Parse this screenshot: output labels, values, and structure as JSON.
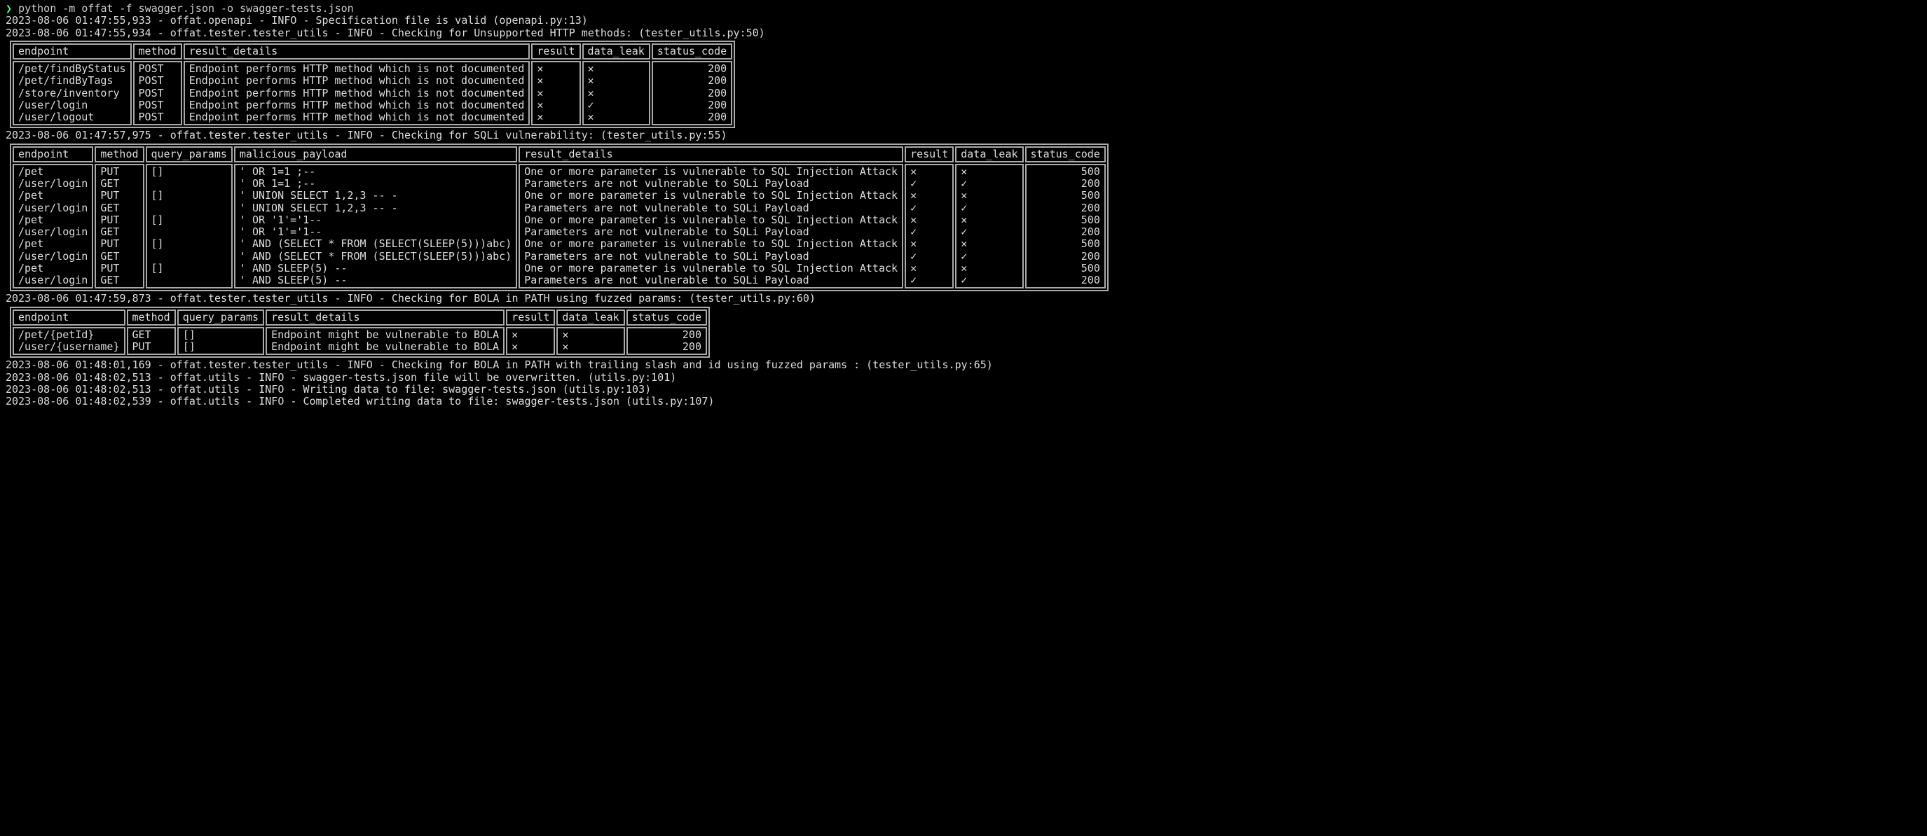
{
  "prompt_symbol": "❯",
  "command": "python -m offat -f swagger.json -o swagger-tests.json",
  "log1": "2023-08-06 01:47:55,933 - offat.openapi - INFO - Specification file is valid (openapi.py:13)",
  "log2": "2023-08-06 01:47:55,934 - offat.tester.tester_utils - INFO - Checking for Unsupported HTTP methods: (tester_utils.py:50)",
  "log3": "2023-08-06 01:47:57,975 - offat.tester.tester_utils - INFO - Checking for SQLi vulnerability: (tester_utils.py:55)",
  "log4": "2023-08-06 01:47:59,873 - offat.tester.tester_utils - INFO - Checking for BOLA in PATH using fuzzed params: (tester_utils.py:60)",
  "log5": "2023-08-06 01:48:01,169 - offat.tester.tester_utils - INFO - Checking for BOLA in PATH with trailing slash and id using fuzzed params : (tester_utils.py:65)",
  "log6": "",
  "log7": "2023-08-06 01:48:02,513 - offat.utils - INFO - swagger-tests.json file will be overwritten. (utils.py:101)",
  "log8": "2023-08-06 01:48:02,513 - offat.utils - INFO - Writing data to file: swagger-tests.json (utils.py:103)",
  "log9": "2023-08-06 01:48:02,539 - offat.utils - INFO - Completed writing data to file: swagger-tests.json (utils.py:107)",
  "table1": {
    "headers": {
      "endpoint": "endpoint",
      "method": "method",
      "result_details": "result_details",
      "result": "result",
      "data_leak": "data_leak",
      "status_code": "status_code"
    },
    "rows": [
      {
        "endpoint": "/pet/findByStatus",
        "method": "POST",
        "result_details": "Endpoint performs HTTP method which is not documented",
        "result": "✕",
        "data_leak": "✕",
        "status_code": "200"
      },
      {
        "endpoint": "/pet/findByTags",
        "method": "POST",
        "result_details": "Endpoint performs HTTP method which is not documented",
        "result": "✕",
        "data_leak": "✕",
        "status_code": "200"
      },
      {
        "endpoint": "/store/inventory",
        "method": "POST",
        "result_details": "Endpoint performs HTTP method which is not documented",
        "result": "✕",
        "data_leak": "✕",
        "status_code": "200"
      },
      {
        "endpoint": "/user/login",
        "method": "POST",
        "result_details": "Endpoint performs HTTP method which is not documented",
        "result": "✕",
        "data_leak": "✓",
        "status_code": "200"
      },
      {
        "endpoint": "/user/logout",
        "method": "POST",
        "result_details": "Endpoint performs HTTP method which is not documented",
        "result": "✕",
        "data_leak": "✕",
        "status_code": "200"
      }
    ]
  },
  "table2": {
    "headers": {
      "endpoint": "endpoint",
      "method": "method",
      "query_params": "query_params",
      "malicious_payload": "malicious_payload",
      "result_details": "result_details",
      "result": "result",
      "data_leak": "data_leak",
      "status_code": "status_code"
    },
    "rows": [
      {
        "endpoint": "/pet",
        "method": "PUT",
        "query_params": "[]",
        "malicious_payload": "' OR 1=1 ;--",
        "result_details": "One or more parameter is vulnerable to SQL Injection Attack",
        "result": "✕",
        "data_leak": "✕",
        "status_code": "500"
      },
      {
        "endpoint": "/user/login",
        "method": "GET",
        "query_params": "",
        "malicious_payload": "' OR 1=1 ;--",
        "result_details": "Parameters are not vulnerable to SQLi Payload",
        "result": "✓",
        "data_leak": "✓",
        "status_code": "200"
      },
      {
        "endpoint": "/pet",
        "method": "PUT",
        "query_params": "[]",
        "malicious_payload": "' UNION SELECT 1,2,3 -- -",
        "result_details": "One or more parameter is vulnerable to SQL Injection Attack",
        "result": "✕",
        "data_leak": "✕",
        "status_code": "500"
      },
      {
        "endpoint": "/user/login",
        "method": "GET",
        "query_params": "",
        "malicious_payload": "' UNION SELECT 1,2,3 -- -",
        "result_details": "Parameters are not vulnerable to SQLi Payload",
        "result": "✓",
        "data_leak": "✓",
        "status_code": "200"
      },
      {
        "endpoint": "/pet",
        "method": "PUT",
        "query_params": "[]",
        "malicious_payload": "' OR '1'='1--",
        "result_details": "One or more parameter is vulnerable to SQL Injection Attack",
        "result": "✕",
        "data_leak": "✕",
        "status_code": "500"
      },
      {
        "endpoint": "/user/login",
        "method": "GET",
        "query_params": "",
        "malicious_payload": "' OR '1'='1--",
        "result_details": "Parameters are not vulnerable to SQLi Payload",
        "result": "✓",
        "data_leak": "✓",
        "status_code": "200"
      },
      {
        "endpoint": "/pet",
        "method": "PUT",
        "query_params": "[]",
        "malicious_payload": "' AND (SELECT * FROM (SELECT(SLEEP(5)))abc)",
        "result_details": "One or more parameter is vulnerable to SQL Injection Attack",
        "result": "✕",
        "data_leak": "✕",
        "status_code": "500"
      },
      {
        "endpoint": "/user/login",
        "method": "GET",
        "query_params": "",
        "malicious_payload": "' AND (SELECT * FROM (SELECT(SLEEP(5)))abc)",
        "result_details": "Parameters are not vulnerable to SQLi Payload",
        "result": "✓",
        "data_leak": "✓",
        "status_code": "200"
      },
      {
        "endpoint": "/pet",
        "method": "PUT",
        "query_params": "[]",
        "malicious_payload": "' AND SLEEP(5) --",
        "result_details": "One or more parameter is vulnerable to SQL Injection Attack",
        "result": "✕",
        "data_leak": "✕",
        "status_code": "500"
      },
      {
        "endpoint": "/user/login",
        "method": "GET",
        "query_params": "",
        "malicious_payload": "' AND SLEEP(5) --",
        "result_details": "Parameters are not vulnerable to SQLi Payload",
        "result": "✓",
        "data_leak": "✓",
        "status_code": "200"
      }
    ]
  },
  "table3": {
    "headers": {
      "endpoint": "endpoint",
      "method": "method",
      "query_params": "query_params",
      "result_details": "result_details",
      "result": "result",
      "data_leak": "data_leak",
      "status_code": "status_code"
    },
    "rows": [
      {
        "endpoint": "/pet/{petId}",
        "method": "GET",
        "query_params": "[]",
        "result_details": "Endpoint might be vulnerable to BOLA",
        "result": "✕",
        "data_leak": "✕",
        "status_code": "200"
      },
      {
        "endpoint": "/user/{username}",
        "method": "PUT",
        "query_params": "[]",
        "result_details": "Endpoint might be vulnerable to BOLA",
        "result": "✕",
        "data_leak": "✕",
        "status_code": "200"
      }
    ]
  }
}
